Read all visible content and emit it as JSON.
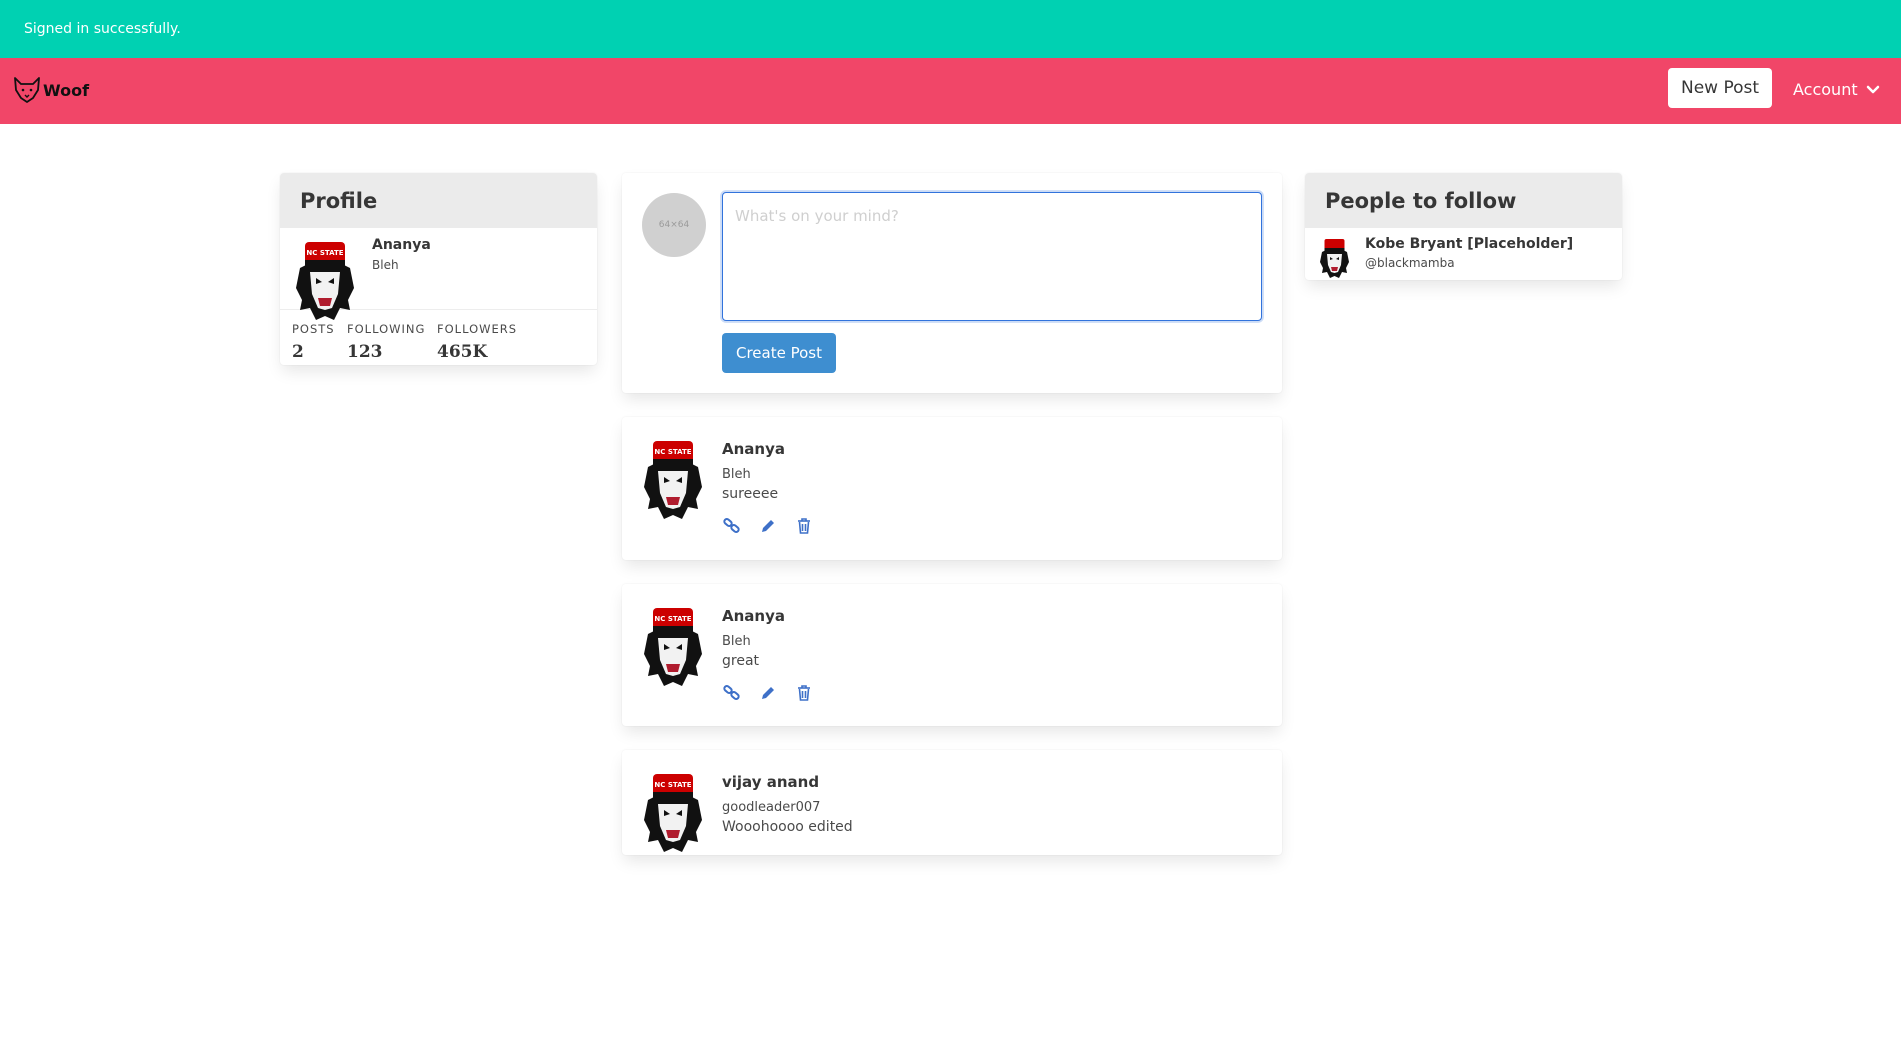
{
  "flash": {
    "message": "Signed in successfully."
  },
  "navbar": {
    "brand": "Woof",
    "new_post_label": "New Post",
    "account_label": "Account",
    "brand_icon": "wolf-head-icon",
    "account_icon": "chevron-down-icon",
    "bg_color": "#f14668"
  },
  "profile": {
    "header": "Profile",
    "name": "Ananya",
    "username": "Bleh",
    "stats": [
      {
        "label": "POSTS",
        "value": "2"
      },
      {
        "label": "FOLLOWING",
        "value": "123"
      },
      {
        "label": "FOLLOWERS",
        "value": "465K"
      }
    ]
  },
  "compose": {
    "placeholder": "What's on your mind?",
    "button_label": "Create Post",
    "avatar_text": "64×64"
  },
  "posts": [
    {
      "name": "Ananya",
      "username": "Bleh",
      "body": "sureeee",
      "actions": [
        "link-icon",
        "edit-icon",
        "trash-icon"
      ]
    },
    {
      "name": "Ananya",
      "username": "Bleh",
      "body": "great",
      "actions": [
        "link-icon",
        "edit-icon",
        "trash-icon"
      ]
    },
    {
      "name": "vijay anand",
      "username": "goodleader007",
      "body": "Wooohoooo edited",
      "actions": []
    }
  ],
  "follow": {
    "header": "People to follow",
    "people": [
      {
        "name": "Kobe Bryant [Placeholder]",
        "handle": "@blackmamba"
      }
    ]
  },
  "colors": {
    "flash_bg": "#00d1b2",
    "primary_button": "#3e8ed0",
    "action_icons": "#3e70c8"
  }
}
